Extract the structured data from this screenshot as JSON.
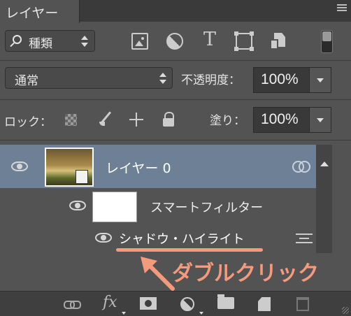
{
  "panel": {
    "tab_label": "レイヤー",
    "menu_icon": "panel-menu-icon"
  },
  "filter_bar": {
    "kind_label": "種類",
    "icons": [
      "search-icon",
      "image-filter-icon",
      "adjustment-filter-icon",
      "type-filter-icon",
      "shape-filter-icon",
      "smart-object-filter-icon",
      "filter-toggle-icon"
    ],
    "type_glyph": "T"
  },
  "blend": {
    "mode": "通常",
    "opacity_label": "不透明度：",
    "opacity_value": "100%"
  },
  "lock": {
    "label": "ロック：",
    "icons": [
      "lock-transparent-pixels-icon",
      "lock-image-pixels-icon",
      "lock-position-icon",
      "lock-all-icon"
    ],
    "fill_label": "塗り：",
    "fill_value": "100%"
  },
  "layers": [
    {
      "name": "レイヤー 0",
      "selected": true,
      "visible": true,
      "smart_filters": {
        "label": "スマートフィルター",
        "filters": [
          {
            "name": "シャドウ・ハイライト"
          }
        ]
      }
    }
  ],
  "annotation": {
    "text": "ダブルクリック",
    "color": "#f59a7c"
  },
  "bottom_bar": {
    "fx_label": "fx",
    "icons": [
      "link-layers-icon",
      "layer-style-icon",
      "add-mask-icon",
      "new-adjustment-layer-icon",
      "new-group-icon",
      "new-layer-icon",
      "delete-layer-icon"
    ]
  },
  "colors": {
    "panel_bg": "#535353",
    "selected_row": "#6e8096",
    "annotation": "#f59a7c"
  }
}
